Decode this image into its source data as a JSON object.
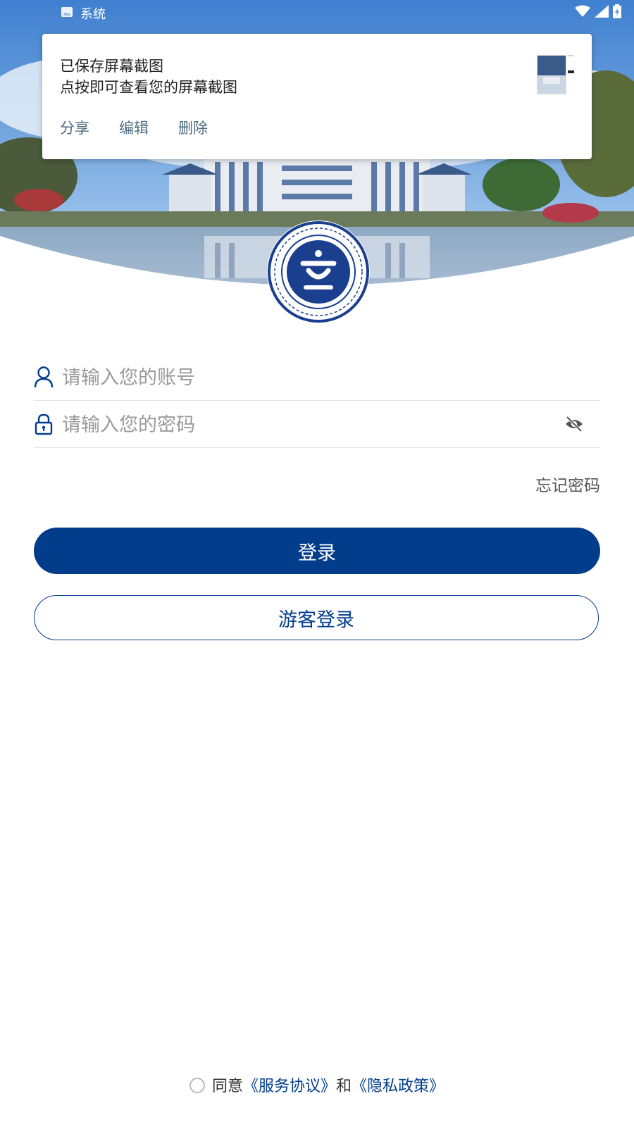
{
  "status_bar": {
    "app_label": "系统",
    "icons": [
      "image-icon",
      "wifi-icon",
      "signal-icon",
      "battery-charging-icon"
    ]
  },
  "notification": {
    "title": "已保存屏幕截图",
    "body": "点按即可查看您的屏幕截图",
    "actions": [
      "分享",
      "编辑",
      "删除"
    ]
  },
  "form": {
    "account_placeholder": "请输入您的账号",
    "password_placeholder": "请输入您的密码",
    "forgot_password": "忘记密码",
    "login_button": "登录",
    "guest_login_button": "游客登录"
  },
  "agreement": {
    "prefix": "同意",
    "service": "《服务协议》",
    "and": "和",
    "privacy": "《隐私政策》"
  },
  "colors": {
    "primary": "#023d8c",
    "notification_action": "#4d6a80"
  }
}
